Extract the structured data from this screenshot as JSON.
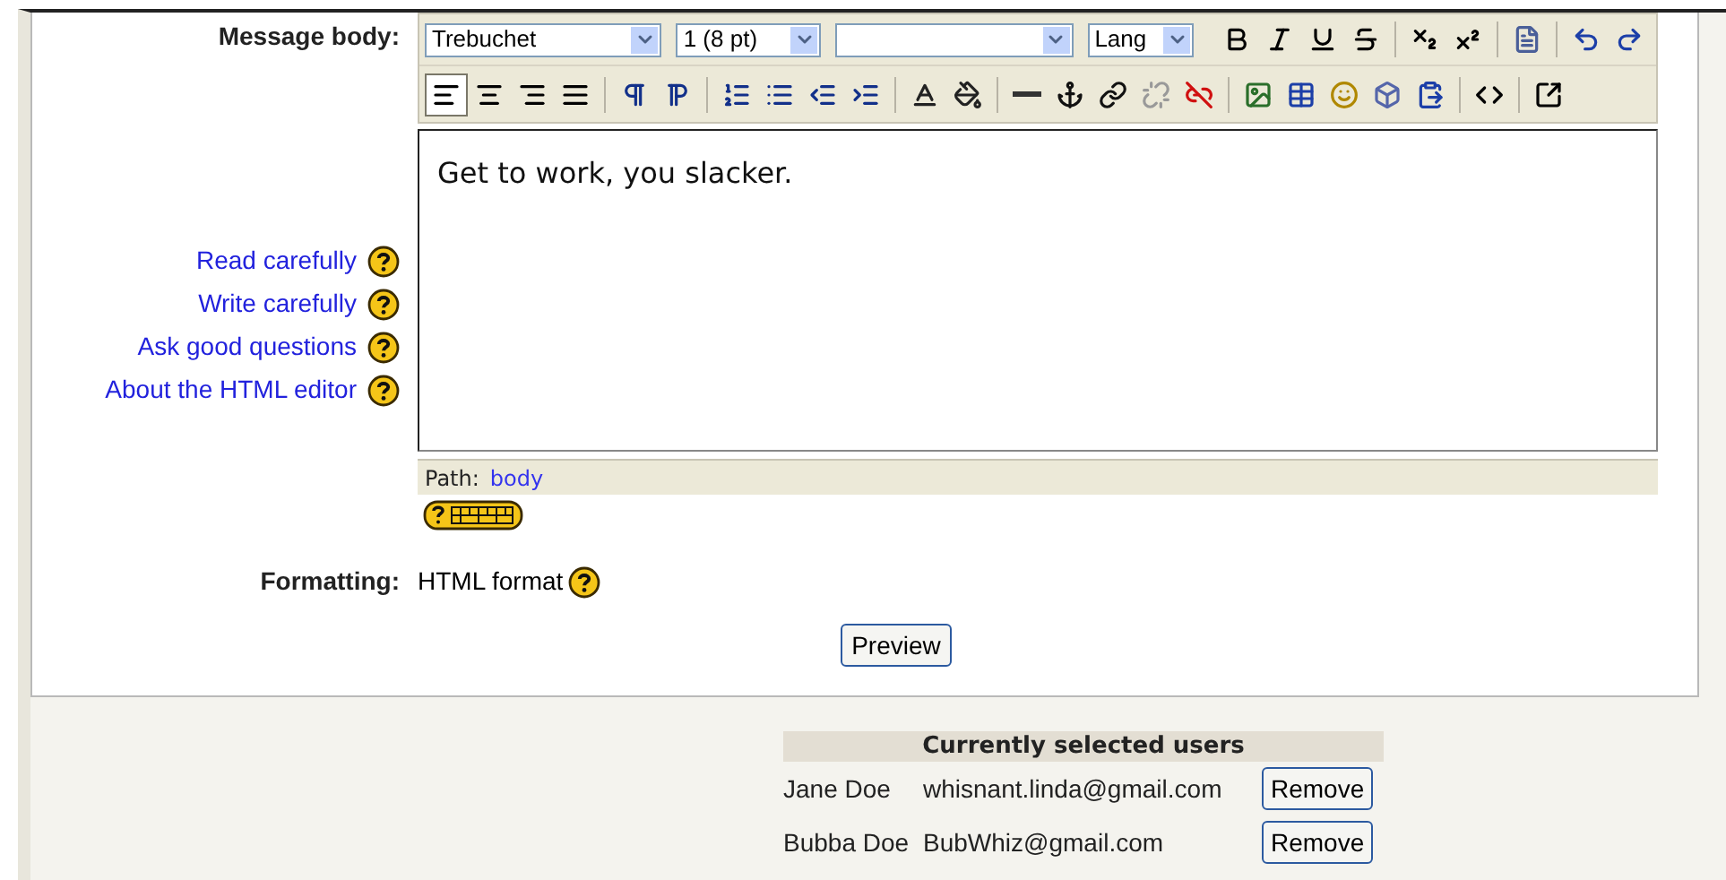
{
  "message_body": {
    "label": "Message body:",
    "help_links": [
      {
        "label": "Read carefully"
      },
      {
        "label": "Write carefully"
      },
      {
        "label": "Ask good questions"
      },
      {
        "label": "About the HTML editor"
      }
    ],
    "selects": [
      {
        "kind": "dropdown",
        "value": "Trebuchet"
      },
      {
        "kind": "dropdown",
        "value": "1 (8 pt)"
      },
      {
        "kind": "dropdown"
      },
      {
        "kind": "dropdown",
        "value": "Lang"
      }
    ],
    "format_buttons": [
      {
        "kind": "bold"
      },
      {
        "kind": "italic"
      },
      {
        "kind": "underline"
      },
      {
        "kind": "strike"
      },
      {
        "kind": "sep"
      },
      {
        "kind": "subscript"
      },
      {
        "kind": "superscript"
      },
      {
        "kind": "sep"
      },
      {
        "kind": "word"
      },
      {
        "kind": "sep"
      },
      {
        "kind": "undo"
      },
      {
        "kind": "redo"
      }
    ],
    "tool_buttons": [
      {
        "kind": "align-left",
        "selected": true
      },
      {
        "kind": "align-center",
        "selected": false
      },
      {
        "kind": "align-right",
        "selected": false
      },
      {
        "kind": "align-justify",
        "selected": false
      },
      {
        "kind": "sep"
      },
      {
        "kind": "ltr",
        "selected": false
      },
      {
        "kind": "rtl",
        "selected": false
      },
      {
        "kind": "sep"
      },
      {
        "kind": "ordered-list",
        "selected": false
      },
      {
        "kind": "bullet-list",
        "selected": false
      },
      {
        "kind": "outdent",
        "selected": false
      },
      {
        "kind": "indent",
        "selected": false
      },
      {
        "kind": "sep"
      },
      {
        "kind": "text-color",
        "selected": false
      },
      {
        "kind": "fill-color",
        "selected": false
      },
      {
        "kind": "sep"
      },
      {
        "kind": "rule",
        "selected": false
      },
      {
        "kind": "anchor",
        "selected": false
      },
      {
        "kind": "link",
        "selected": false
      },
      {
        "kind": "unlink",
        "selected": false
      },
      {
        "kind": "nolink",
        "selected": false
      },
      {
        "kind": "sep"
      },
      {
        "kind": "image",
        "selected": false
      },
      {
        "kind": "table",
        "selected": false
      },
      {
        "kind": "smiley",
        "selected": false
      },
      {
        "kind": "special",
        "selected": false
      },
      {
        "kind": "paste",
        "selected": false
      },
      {
        "kind": "sep"
      },
      {
        "kind": "source",
        "selected": false
      },
      {
        "kind": "sep"
      },
      {
        "kind": "fullscreen",
        "selected": false
      }
    ],
    "text": "Get to work, you slacker.",
    "path_label": "Path:",
    "path_value": "body"
  },
  "formatting": {
    "label": "Formatting:",
    "value": "HTML format"
  },
  "preview_button": "Preview",
  "selected_users": {
    "title": "Currently selected users",
    "rows": [
      {
        "name": "Jane Doe",
        "email": "whisnant.linda@gmail.com",
        "action": "Remove"
      },
      {
        "name": "Bubba Doe",
        "email": "BubWhiz@gmail.com",
        "action": "Remove"
      }
    ]
  }
}
